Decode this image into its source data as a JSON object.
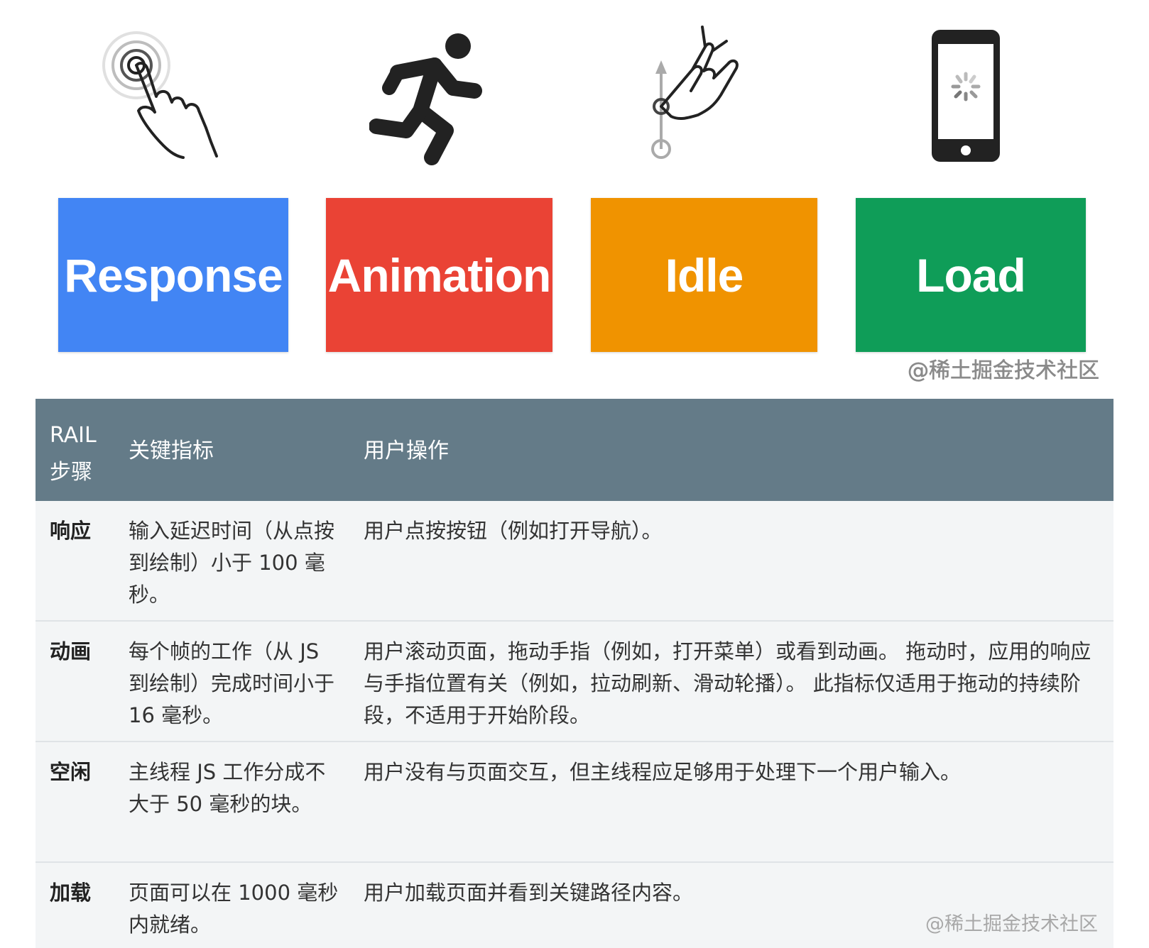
{
  "cards": [
    {
      "label": "Response",
      "color": "#4285f4",
      "icon": "touch-tap-icon"
    },
    {
      "label": "Animation",
      "color": "#ea4335",
      "icon": "running-person-icon"
    },
    {
      "label": "Idle",
      "color": "#f09300",
      "icon": "swipe-gesture-icon"
    },
    {
      "label": "Load",
      "color": "#0f9d58",
      "icon": "phone-loading-icon"
    }
  ],
  "watermark": "@稀土掘金技术社区",
  "table": {
    "headers": {
      "step": "RAIL 步骤",
      "metric": "关键指标",
      "action": "用户操作"
    },
    "rows": [
      {
        "name": "响应",
        "metric": "输入延迟时间（从点按到绘制）小于 100 毫秒。",
        "action": "用户点按按钮（例如打开导航）。"
      },
      {
        "name": "动画",
        "metric": "每个帧的工作（从 JS 到绘制）完成时间小于 16 毫秒。",
        "action": "用户滚动页面，拖动手指（例如，打开菜单）或看到动画。 拖动时，应用的响应与手指位置有关（例如，拉动刷新、滑动轮播）。 此指标仅适用于拖动的持续阶段，不适用于开始阶段。"
      },
      {
        "name": "空闲",
        "metric": "主线程 JS 工作分成不大于 50 毫秒的块。",
        "action": "用户没有与页面交互，但主线程应足够用于处理下一个用户输入。"
      },
      {
        "name": "加载",
        "metric": "页面可以在 1000 毫秒内就绪。",
        "action": "用户加载页面并看到关键路径内容。"
      }
    ]
  }
}
